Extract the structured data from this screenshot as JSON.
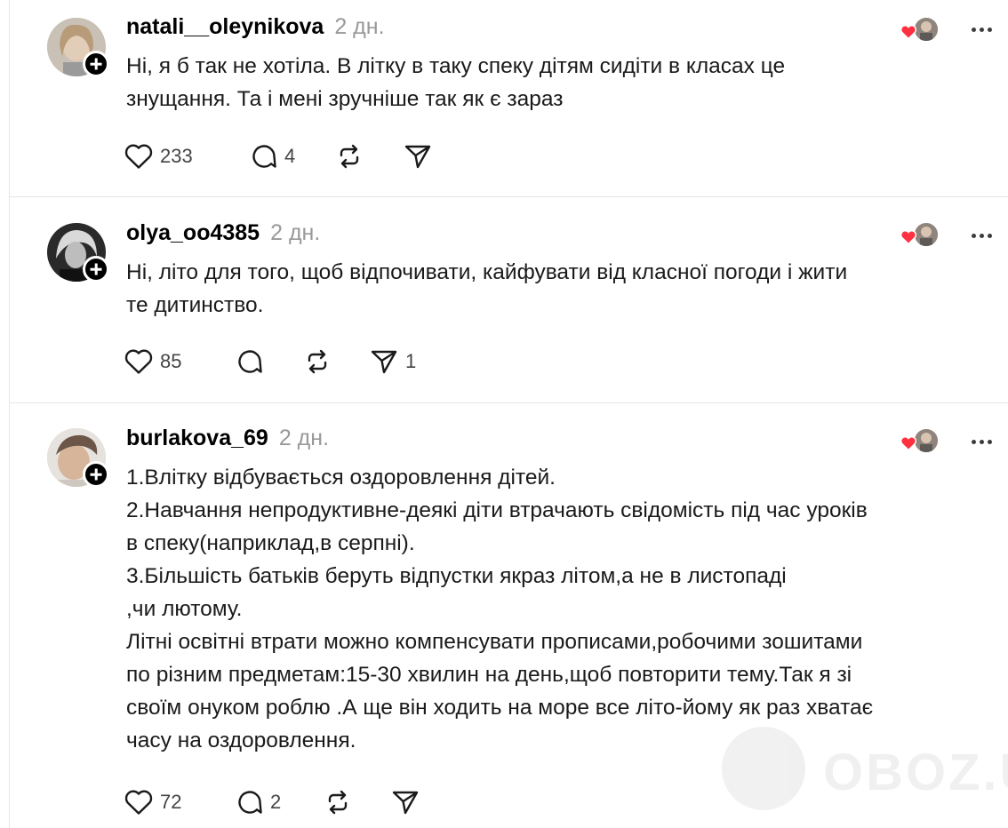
{
  "posts": [
    {
      "username": "natali__oleynikova",
      "time": "2 дн.",
      "lines": [
        "Ні, я б так не хотіла. В літку в таку спеку дітям сидіти в класах це",
        "знущання. Та і мені зручніше так як є зараз"
      ],
      "likes": "233",
      "replies": "4",
      "reposts": "",
      "shares": ""
    },
    {
      "username": "olya_oo4385",
      "time": "2 дн.",
      "lines": [
        "Ні, літо для того, щоб відпочивати, кайфувати від класної погоди і жити",
        "те дитинство."
      ],
      "likes": "85",
      "replies": "",
      "reposts": "",
      "shares": "1"
    },
    {
      "username": "burlakova_69",
      "time": "2 дн.",
      "lines": [
        "1.Влітку відбувається оздоровлення дітей.",
        "2.Навчання непродуктивне-деякі діти втрачають свідомість під час уроків",
        "в спеку(наприклад,в серпні).",
        "3.Більшість батьків беруть відпустки якраз літом,а не в листопаді",
        ",чи лютому.",
        "Літні освітні втрати можно компенсувати прописами,робочими зошитами",
        "по різним предметам:15-30 хвилин на день,щоб повторити тему.Так я зі",
        "своїм онуком роблю .А ще він ходить на море все літо-йому як раз хватає",
        "часу на оздоровлення."
      ],
      "likes": "72",
      "replies": "2",
      "reposts": "",
      "shares": ""
    }
  ],
  "watermark": {
    "text": "OBOZ.UA"
  },
  "icons": {
    "like": "heart-outline-icon",
    "reply": "speech-bubble-icon",
    "repost": "repost-arrows-icon",
    "share": "paper-plane-icon",
    "more": "ellipsis-icon",
    "follow": "plus-icon",
    "liked": "heart-filled-icon"
  },
  "colors": {
    "heart": "#ff3040",
    "muted": "#999999",
    "text": "#1a1a1a",
    "divider": "#e5e5e5"
  }
}
